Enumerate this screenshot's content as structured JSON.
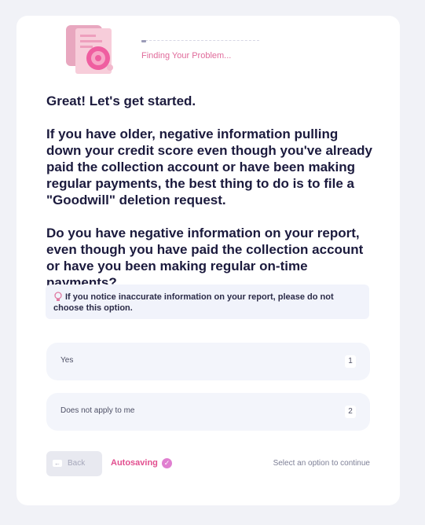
{
  "header": {
    "status": "Finding Your Problem...",
    "progress_fraction": 0.04
  },
  "question": {
    "line1": "Great! Let's get started.",
    "line2": "If you have older, negative information pulling down your credit score even though you've already paid the collection account or have been making regular payments, the best thing to do is to file a \"Goodwill\" deletion request.",
    "line3": "Do you have negative information on your report, even though you have paid the collection account or have you been making regular on-time payments?"
  },
  "notice": {
    "icon": "lightbulb-icon",
    "text": "If you notice inaccurate information on your report, please do not choose this option."
  },
  "options": [
    {
      "label": "Yes",
      "key": "1"
    },
    {
      "label": "Does not apply to me",
      "key": "2"
    }
  ],
  "footer": {
    "back_label": "Back",
    "autosave_label": "Autosaving",
    "hint": "Select an option to continue"
  },
  "colors": {
    "accent_pink": "#e24f8f",
    "card_bg": "#ffffff",
    "page_bg": "#f1f2f7",
    "option_bg": "#f3f5fb"
  }
}
